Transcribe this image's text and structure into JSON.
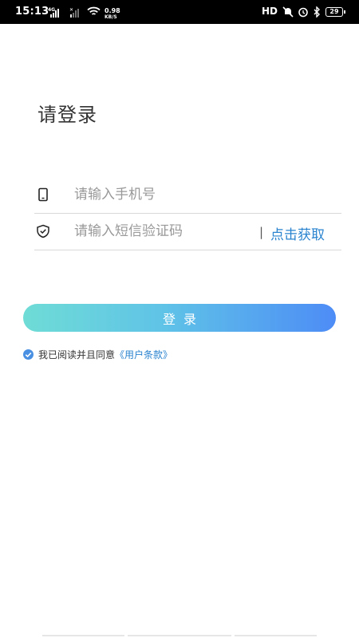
{
  "status_bar": {
    "time": "15:13",
    "sim1_label": "4G",
    "sim2_label": "✕",
    "net_speed_value": "0.98",
    "net_speed_unit": "KB/S",
    "hd_label": "HD",
    "battery": "29",
    "icons": [
      "signal-icon",
      "signal-icon",
      "wifi-icon",
      "mute-icon",
      "alarm-icon",
      "bluetooth-icon",
      "battery-icon"
    ]
  },
  "page": {
    "title": "请登录"
  },
  "form": {
    "phone_placeholder": "请输入手机号",
    "code_placeholder": "请输入短信验证码",
    "divider": "|",
    "get_code_label": "点击获取",
    "phone_icon": "phone-icon",
    "code_icon": "shield-check-icon"
  },
  "login_button": {
    "label": "登录"
  },
  "agreement": {
    "checked": true,
    "text": "我已阅读并且同意",
    "link_label": "《用户条款》"
  },
  "colors": {
    "accent": "#2a83cf",
    "gradient_start": "#6fdcd6",
    "gradient_end": "#4d8cf6",
    "check": "#4a90e2"
  }
}
